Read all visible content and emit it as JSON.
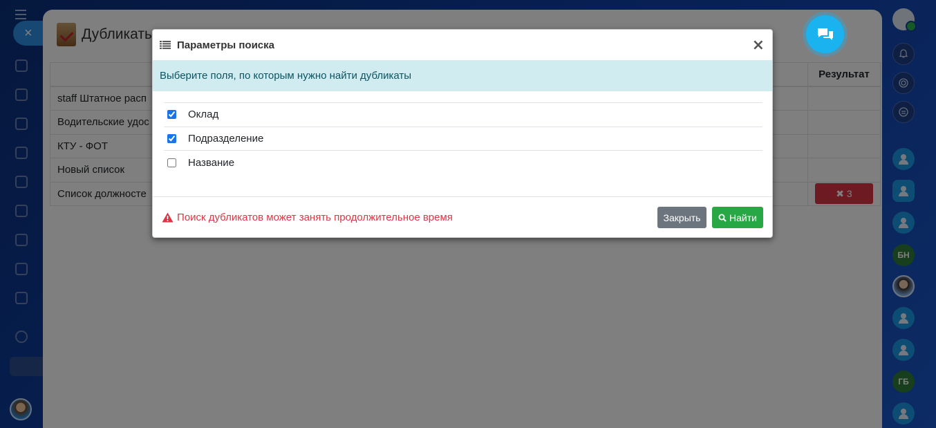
{
  "background_window": {
    "title": "Дубликаты в списках",
    "table_header_result": "Результат",
    "rows": [
      {
        "name": "staff Штатное расп",
        "result": ""
      },
      {
        "name": "Водительские удос",
        "result": ""
      },
      {
        "name": "КТУ - ФОТ",
        "result": ""
      },
      {
        "name": "Новый список",
        "result": ""
      },
      {
        "name": "Список должносте",
        "result": "✖ 3"
      }
    ]
  },
  "right_sidebar": {
    "badges": [
      "БН",
      "ГБ"
    ]
  },
  "modal": {
    "title": "Параметры поиска",
    "close_symbol": "×",
    "info_text": "Выберите поля, по которым нужно найти дубликаты",
    "fields": [
      {
        "label": "Оклад",
        "checked": true
      },
      {
        "label": "Подразделение",
        "checked": true
      },
      {
        "label": "Название",
        "checked": false
      }
    ],
    "warning_text": "Поиск дубликатов может занять продолжительное время",
    "close_button_label": "Закрыть",
    "find_button_label": "Найти"
  },
  "colors": {
    "info_bg": "#d1ecf1",
    "danger": "#dc3545",
    "success": "#28a745",
    "secondary": "#6c757d",
    "chat_accent": "#1ab3f0"
  },
  "icons": [
    "list-icon",
    "close-icon",
    "warning-triangle-icon",
    "search-icon",
    "chat-bubbles-icon",
    "bell-icon",
    "user-avatar-icon"
  ]
}
